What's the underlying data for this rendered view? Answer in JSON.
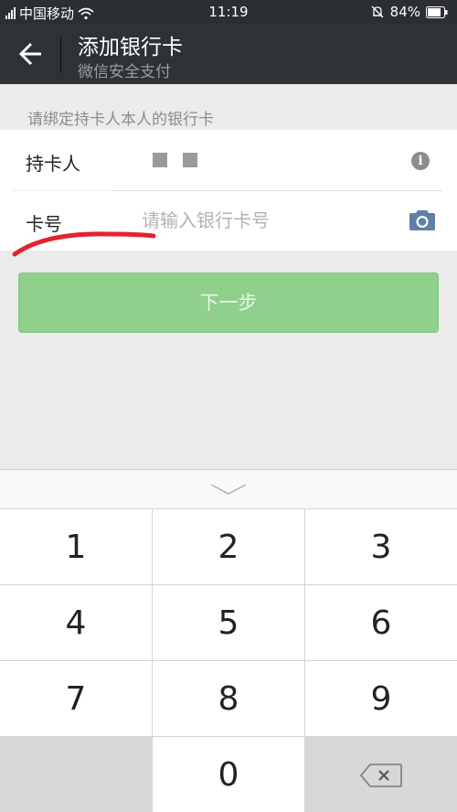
{
  "status_bar": {
    "carrier": "中国移动",
    "time": "11:19",
    "battery": "84%"
  },
  "header": {
    "title": "添加银行卡",
    "subtitle": "微信安全支付"
  },
  "hint": "请绑定持卡人本人的银行卡",
  "form": {
    "holder_label": "持卡人",
    "card_label": "卡号",
    "card_placeholder": "请输入银行卡号",
    "card_value": ""
  },
  "next_button": "下一步",
  "keypad": {
    "keys": [
      "1",
      "2",
      "3",
      "4",
      "5",
      "6",
      "7",
      "8",
      "9",
      "0"
    ]
  },
  "colors": {
    "header_bg": "#2e3136",
    "button_green": "#90d08d",
    "annotation_red": "#e5222d",
    "camera_icon": "#5f7fa6"
  }
}
